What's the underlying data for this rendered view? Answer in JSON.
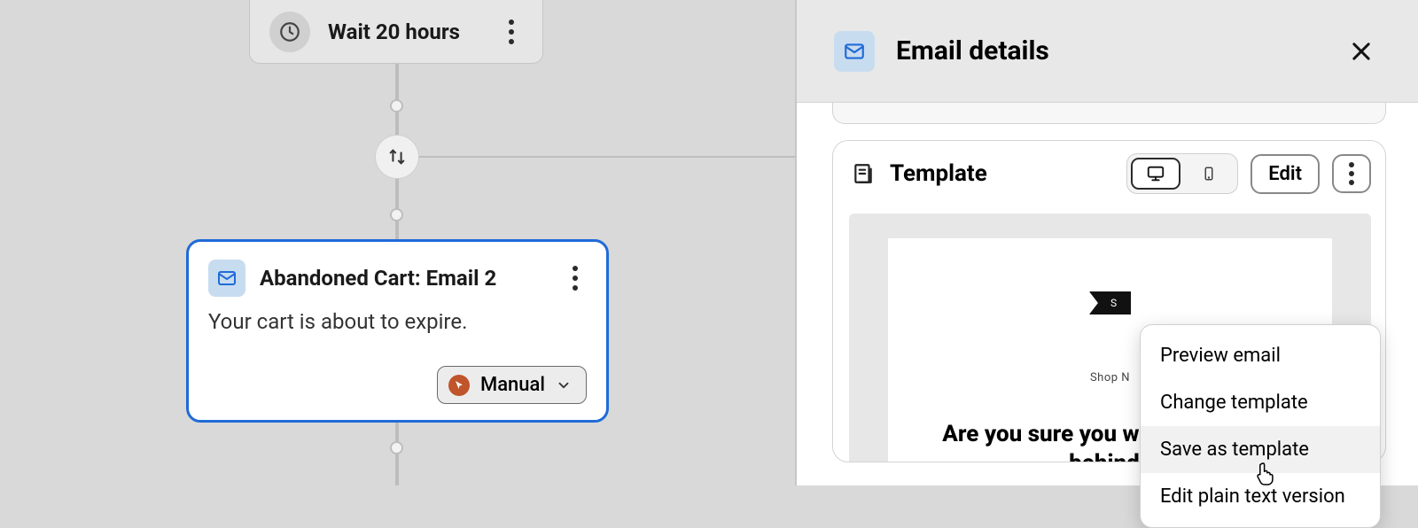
{
  "canvas": {
    "wait_node": {
      "label": "Wait 20 hours"
    },
    "email_node": {
      "title": "Abandoned Cart: Email 2",
      "description": "Your cart is about to expire.",
      "status_label": "Manual"
    }
  },
  "panel": {
    "title": "Email details",
    "template": {
      "label": "Template",
      "edit_label": "Edit",
      "menu": {
        "preview": "Preview email",
        "change": "Change template",
        "save_as": "Save as template",
        "plaintext": "Edit plain text version"
      },
      "preview": {
        "banner": "S",
        "nav": "Shop N",
        "headline": "Are you sure you want leave this behind?"
      }
    }
  }
}
